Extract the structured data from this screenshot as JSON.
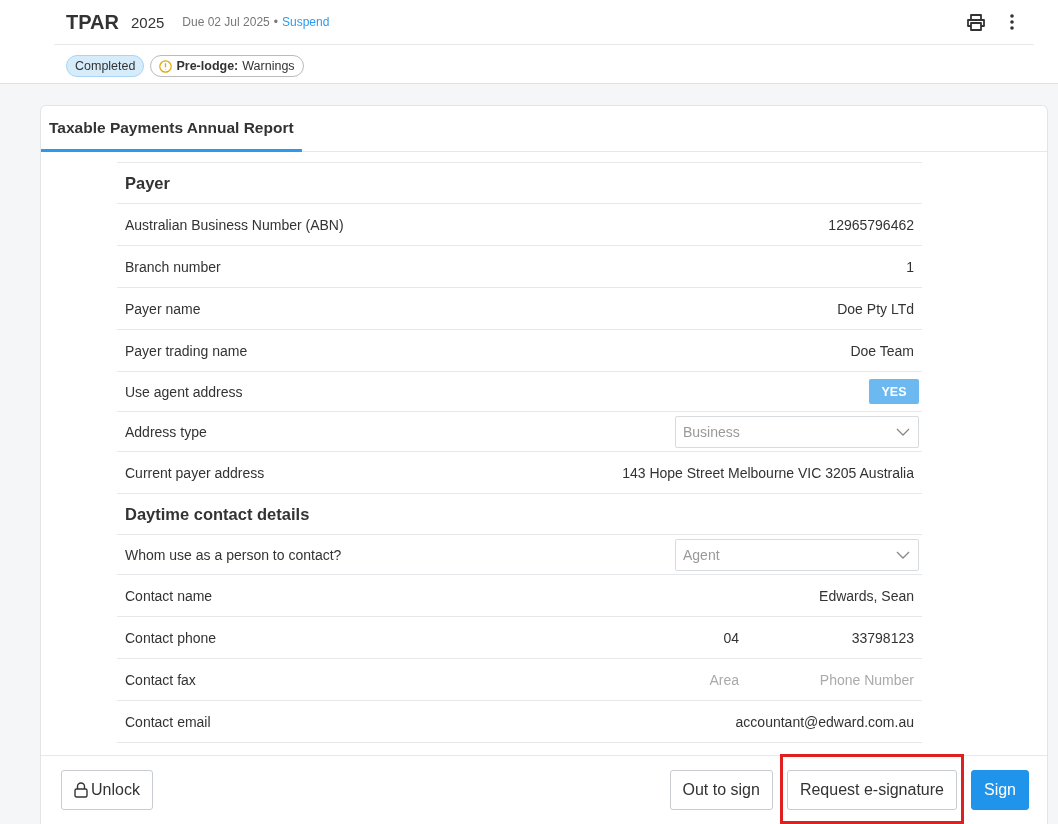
{
  "header": {
    "title": "TPAR",
    "year": "2025",
    "due": "Due 02 Jul 2025",
    "separator": "•",
    "action": "Suspend",
    "badges": [
      {
        "kind": "status",
        "text": "Completed"
      },
      {
        "kind": "warning",
        "label": "Pre-lodge:",
        "text": "Warnings"
      }
    ]
  },
  "tabs": [
    {
      "label": "Taxable Payments Annual Report",
      "selected": true
    }
  ],
  "sections": [
    {
      "title": "Payer",
      "rows": [
        {
          "kind": "text",
          "label": "Australian Business Number (ABN)",
          "value": "12965796462"
        },
        {
          "kind": "text",
          "label": "Branch number",
          "value": "1"
        },
        {
          "kind": "text",
          "label": "Payer name",
          "value": "Doe Pty LTd"
        },
        {
          "kind": "text",
          "label": "Payer trading name",
          "value": "Doe Team"
        },
        {
          "kind": "toggle",
          "label": "Use agent address",
          "on": true,
          "value": "YES"
        },
        {
          "kind": "select",
          "label": "Address type",
          "value": "Business"
        },
        {
          "kind": "text",
          "label": "Current payer address",
          "value": "143 Hope Street Melbourne VIC 3205 Australia"
        }
      ]
    },
    {
      "title": "Daytime contact details",
      "rows": [
        {
          "kind": "select",
          "label": "Whom use as a person to contact?",
          "value": "Agent"
        },
        {
          "kind": "text",
          "label": "Contact name",
          "value": "Edwards, Sean"
        },
        {
          "kind": "phone",
          "label": "Contact phone",
          "area": "04",
          "number": "33798123"
        },
        {
          "kind": "phone",
          "label": "Contact fax",
          "area_placeholder": "Area",
          "number_placeholder": "Phone Number"
        },
        {
          "kind": "text",
          "label": "Contact email",
          "value": "accountant@edward.com.au"
        }
      ]
    }
  ],
  "footer": {
    "left": [
      {
        "label": "Unlock",
        "kind": "lock"
      }
    ],
    "right": [
      {
        "label": "Out to sign",
        "kind": "default",
        "highlighted": false
      },
      {
        "label": "Request e-signature",
        "kind": "default",
        "highlighted": true
      },
      {
        "label": "Sign",
        "kind": "primary",
        "highlighted": false
      }
    ]
  }
}
